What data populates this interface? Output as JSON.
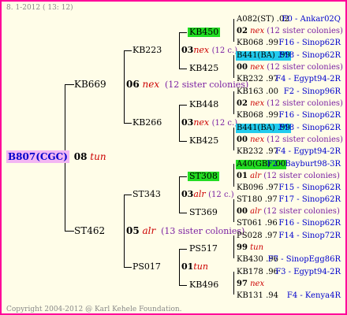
{
  "header": {
    "date": "8.  1-2012 ( 13: 12)"
  },
  "footer": {
    "copyright": "Copyright 2004-2012 @ Karl Kehele Foundation."
  },
  "root": {
    "id": "B807(CGC)",
    "year": "08",
    "breed": "tun"
  },
  "gen1": [
    {
      "id": "KB669",
      "year": "06",
      "breed": "nex",
      "sisters": "(12 sister colonies)"
    },
    {
      "id": "ST462",
      "year": "05",
      "breed": "alr",
      "sisters": "(13 sister colonies)"
    }
  ],
  "gen2": [
    {
      "id": "KB223",
      "year": "03",
      "breed": "nex",
      "sisters": "(12 c.)"
    },
    {
      "id": "KB266",
      "year": "03",
      "breed": "nex",
      "sisters": "(12 c.)"
    },
    {
      "id": "ST343",
      "year": "03",
      "breed": "alr",
      "sisters": "(12 c.)"
    },
    {
      "id": "PS017",
      "year": "01",
      "breed": "tun",
      "sisters": ""
    }
  ],
  "gen3": [
    "KB450",
    "KB425",
    "KB448",
    "KB425",
    "ST308",
    "ST369",
    "PS517",
    "KB496"
  ],
  "gen4": [
    {
      "top": "A082(ST) .02",
      "topRight": "F0 - Ankar02Q",
      "year": "02",
      "breed": "nex",
      "sisters": "(12 sister colonies)",
      "bottom": "KB068 .99",
      "bottomRight": "F16 - Sinop62R"
    },
    {
      "top": "B441(BA) .99",
      "topRight": "F18 - Sinop62R",
      "year": "00",
      "breed": "nex",
      "sisters": "(12 sister colonies)",
      "bottom": "KB232 .97",
      "bottomRight": "F4 - Egypt94-2R"
    },
    {
      "top": "KB163 .00",
      "topRight": "F2 - Sinop96R",
      "year": "02",
      "breed": "nex",
      "sisters": "(12 sister colonies)",
      "bottom": "KB068 .99",
      "bottomRight": "F16 - Sinop62R"
    },
    {
      "top": "B441(BA) .99",
      "topRight": "F18 - Sinop62R",
      "year": "00",
      "breed": "nex",
      "sisters": "(12 sister colonies)",
      "bottom": "KB232 .97",
      "bottomRight": "F4 - Egypt94-2R"
    },
    {
      "top": "A40(GB) .00",
      "topRight": "F2 - Bayburt98-3R",
      "year": "01",
      "breed": "alr",
      "sisters": "(12 sister colonies)",
      "bottom": "KB096 .97",
      "bottomRight": "F15 - Sinop62R"
    },
    {
      "top": "ST180 .97",
      "topRight": "F17 - Sinop62R",
      "year": "00",
      "breed": "alr",
      "sisters": "(12 sister colonies)",
      "bottom": "ST061 .96",
      "bottomRight": "F16 - Sinop62R"
    },
    {
      "top": "PS028 .97",
      "topRight": "F14 - Sinop72R",
      "year": "99",
      "breed": "tun",
      "sisters": "",
      "bottom": "KB430 .96",
      "bottomRight": "F7 - SinopEgg86R"
    },
    {
      "top": "KB178 .96",
      "topRight": "F3 - Egypt94-2R",
      "year": "97",
      "breed": "nex",
      "sisters": "",
      "bottom": "KB131 .94",
      "bottomRight": "F4 - Kenya4R"
    }
  ]
}
